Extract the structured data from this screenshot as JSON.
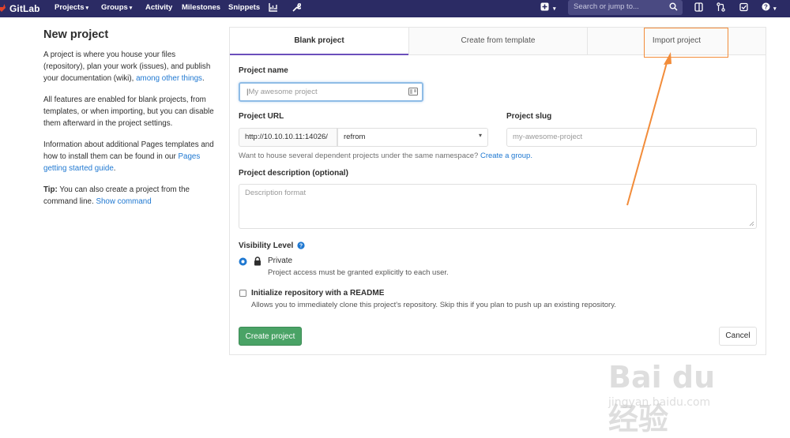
{
  "navbar": {
    "brand": "GitLab",
    "items": [
      "Projects",
      "Groups",
      "Activity",
      "Milestones",
      "Snippets"
    ],
    "search_placeholder": "Search or jump to...",
    "colors": {
      "bg": "#2b2b64",
      "search_bg": "#4a4a82"
    }
  },
  "sidebar": {
    "title": "New project",
    "para1_text": "A project is where you house your files (repository), plan your work (issues), and publish your documentation (wiki), ",
    "para1_link": "among other things",
    "para1_end": ".",
    "para2": "All features are enabled for blank projects, from templates, or when importing, but you can disable them afterward in the project settings.",
    "para3_text": "Information about additional Pages templates and how to install them can be found in our ",
    "para3_link": "Pages getting started guide",
    "para3_end": ".",
    "tip_label": "Tip:",
    "tip_text": " You can also create a project from the command line. ",
    "tip_link": "Show command"
  },
  "tabs": [
    "Blank project",
    "Create from template",
    "Import project"
  ],
  "form": {
    "name_label": "Project name",
    "name_placeholder": "My awesome project",
    "url_label": "Project URL",
    "url_prefix": "http://10.10.10.11:14026/",
    "namespace": "refrom",
    "slug_label": "Project slug",
    "slug_placeholder": "my-awesome-project",
    "namespace_hint": "Want to house several dependent projects under the same namespace? ",
    "namespace_hint_link": "Create a group.",
    "desc_label": "Project description (optional)",
    "desc_placeholder": "Description format",
    "visibility_label": "Visibility Level",
    "visibility_option": "Private",
    "visibility_desc": "Project access must be granted explicitly to each user.",
    "readme_label": "Initialize repository with a README",
    "readme_desc": "Allows you to immediately clone this project's repository. Skip this if you plan to push up an existing repository.",
    "create_button": "Create project",
    "cancel_button": "Cancel"
  },
  "watermark": {
    "big": "Bai du 经验",
    "small": "jingyan.baidu.com"
  },
  "colors": {
    "accent": "#1f78d1",
    "green": "#4aa366",
    "annotation": "#f28c3a",
    "tab_underline": "#6b4fbb"
  }
}
